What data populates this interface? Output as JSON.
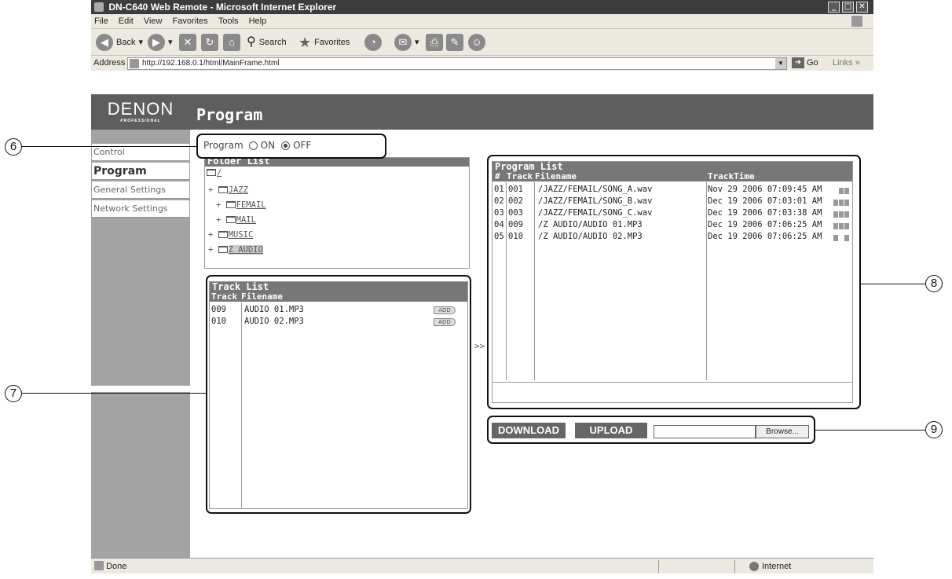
{
  "window": {
    "title": "DN-C640 Web Remote - Microsoft Internet Explorer"
  },
  "menubar": [
    "File",
    "Edit",
    "View",
    "Favorites",
    "Tools",
    "Help"
  ],
  "toolbar": {
    "back": "Back",
    "search": "Search",
    "favorites": "Favorites"
  },
  "address": {
    "label": "Address",
    "url": "http://192.168.0.1/html/MainFrame.html",
    "go": "Go",
    "links": "Links"
  },
  "logo": {
    "brand": "DENON",
    "sub": "PROFESSIONAL"
  },
  "page": {
    "title": "Program"
  },
  "sidebar": {
    "items": [
      "Control",
      "Program",
      "General Settings",
      "Network Settings"
    ]
  },
  "program_toggle": {
    "label": "Program",
    "on": "ON",
    "off": "OFF",
    "selected": "OFF"
  },
  "folder_list": {
    "title": "Folder List",
    "root": "/",
    "items": [
      {
        "prefix": "+",
        "name": "JAZZ"
      },
      {
        "prefix": "+",
        "name": "FEMAIL"
      },
      {
        "prefix": "+",
        "name": "MAIL"
      },
      {
        "prefix": "+",
        "name": "MUSIC"
      },
      {
        "prefix": "+",
        "name": "Z AUDIO"
      }
    ]
  },
  "track_list": {
    "title": "Track List",
    "col_track": "Track",
    "col_filename": "Filename",
    "add_label": "ADD",
    "rows": [
      {
        "track": "009",
        "filename": "AUDIO 01.MP3"
      },
      {
        "track": "010",
        "filename": "AUDIO 02.MP3"
      }
    ]
  },
  "move_arrow": ">>",
  "program_list": {
    "title": "Program List",
    "col_num": "#",
    "col_track": "Track",
    "col_filename": "Filename",
    "col_time": "TrackTime",
    "rows": [
      {
        "num": "01",
        "track": "001",
        "filename": "/JAZZ/FEMAIL/SONG_A.wav",
        "time": "Nov 29 2006 07:09:45 AM"
      },
      {
        "num": "02",
        "track": "002",
        "filename": "/JAZZ/FEMAIL/SONG_B.wav",
        "time": "Dec 19 2006 07:03:01 AM"
      },
      {
        "num": "03",
        "track": "003",
        "filename": "/JAZZ/FEMAIL/SONG_C.wav",
        "time": "Dec 19 2006 07:03:38 AM"
      },
      {
        "num": "04",
        "track": "009",
        "filename": "/Z AUDIO/AUDIO 01.MP3",
        "time": "Dec 19 2006 07:06:25 AM"
      },
      {
        "num": "05",
        "track": "010",
        "filename": "/Z AUDIO/AUDIO 02.MP3",
        "time": "Dec 19 2006 07:06:25 AM"
      }
    ]
  },
  "actions": {
    "download": "DOWNLOAD",
    "upload": "UPLOAD",
    "browse": "Browse..."
  },
  "status": {
    "left": "Done",
    "zone": "Internet"
  },
  "callouts": [
    "6",
    "7",
    "8",
    "9"
  ]
}
